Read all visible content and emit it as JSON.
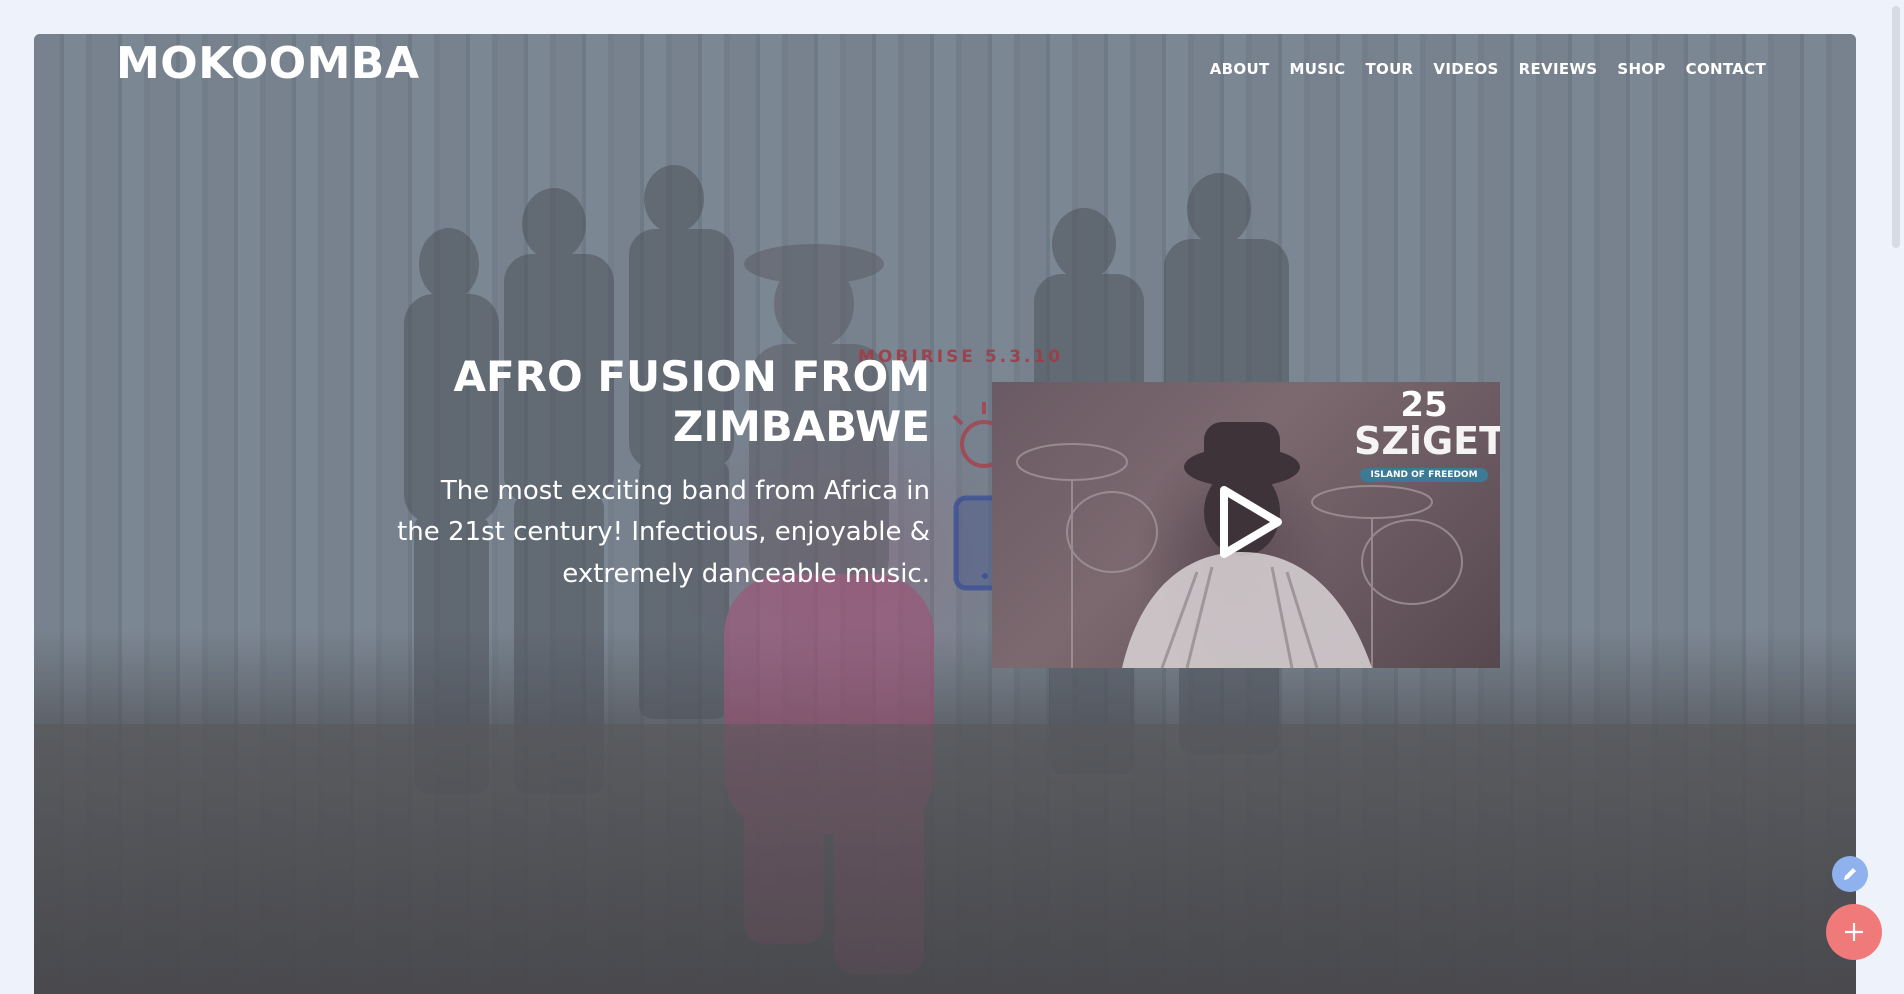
{
  "header": {
    "brand": "MOKOOMBA",
    "nav": [
      "ABOUT",
      "MUSIC",
      "TOUR",
      "VIDEOS",
      "REVIEWS",
      "SHOP",
      "CONTACT"
    ]
  },
  "hero": {
    "title": "AFRO FUSION FROM ZIMBABWE",
    "subtitle": "The most exciting band from Africa in the 21st century! Infectious, enjoyable & extremely danceable music."
  },
  "editor_watermark": {
    "label": "MOBIRISE 5.3.10"
  },
  "video": {
    "badge_number": "25",
    "badge_word": "SZiGET",
    "badge_ribbon": "ISLAND OF FREEDOM",
    "play_icon": "play-icon"
  },
  "floating_actions": {
    "edit_icon": "pencil-icon",
    "add_icon": "plus-icon"
  },
  "colors": {
    "accent_add": "#f07a7a",
    "accent_edit": "#8fb2ee",
    "page_bg": "#eef3fb"
  }
}
